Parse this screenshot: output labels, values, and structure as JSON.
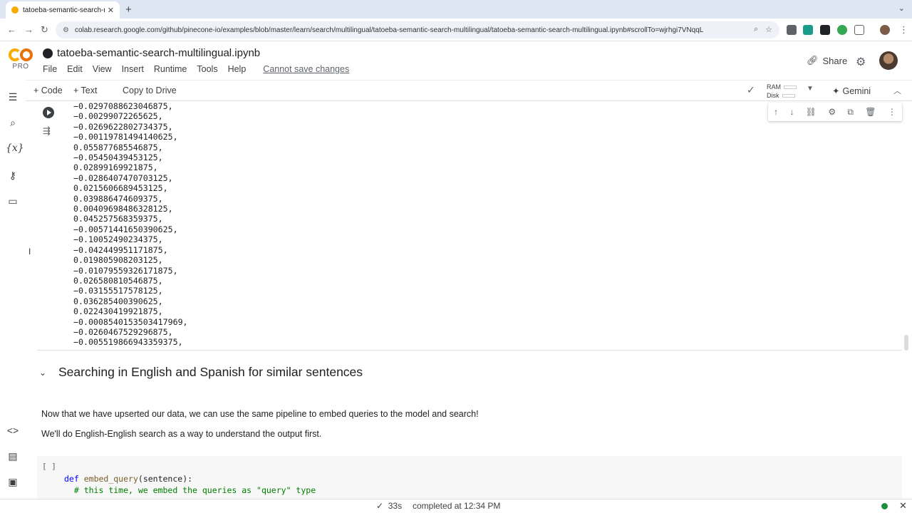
{
  "browser": {
    "tab_title": "tatoeba-semantic-search-m...",
    "url": "colab.research.google.com/github/pinecone-io/examples/blob/master/learn/search/multilingual/tatoeba-semantic-search-multilingual/tatoeba-semantic-search-multilingual.ipynb#scrollTo=wjrhgi7VNqqL"
  },
  "colab": {
    "logo_pro": "PRO",
    "notebook_title": "tatoeba-semantic-search-multilingual.ipynb",
    "menus": [
      "File",
      "Edit",
      "View",
      "Insert",
      "Runtime",
      "Tools",
      "Help"
    ],
    "cannot_save": "Cannot save changes",
    "share": "Share"
  },
  "toolbar": {
    "code": "+ Code",
    "text": "+ Text",
    "copy_to_drive": "Copy to Drive",
    "ram": "RAM",
    "disk": "Disk",
    "gemini": "Gemini"
  },
  "output_lines": [
    "-0.0297088623046875,",
    "-0.00299072265625,",
    "-0.0269622802734375,",
    "-0.00119781494140625,",
    "0.055877685546875,",
    "-0.05450439453125,",
    "0.02899169921875,",
    "-0.0286407470703125,",
    "0.0215606689453125,",
    "0.039886474609375,",
    "0.00409698486328125,",
    "0.045257568359375,",
    "-0.00571441650390625,",
    "-0.10052490234375,",
    "-0.042449951171875,",
    "0.019805908203125,",
    "-0.01079559326171875,",
    "0.026580810546875,",
    "-0.03155517578125,",
    "0.036285400390625,",
    "0.022430419921875,",
    "-0.0008540153503417969,",
    "-0.0260467529296875,",
    "-0.005519866943359375,"
  ],
  "section": {
    "heading": "Searching in English and Spanish for similar sentences",
    "para1": "Now that we have upserted our data, we can use the same pipeline to embed queries to the model and search!",
    "para2": "We'll do English-English search as a way to understand the output first."
  },
  "code_cell": {
    "bracket": "[ ]",
    "kw_def": "def",
    "fn_name": "embed_query",
    "sig_rest": "(sentence):",
    "comment": "# this time, we embed the queries as \"query\" type"
  },
  "status": {
    "check": "✓",
    "elapsed": "33s",
    "completed": "completed at 12:34 PM"
  }
}
